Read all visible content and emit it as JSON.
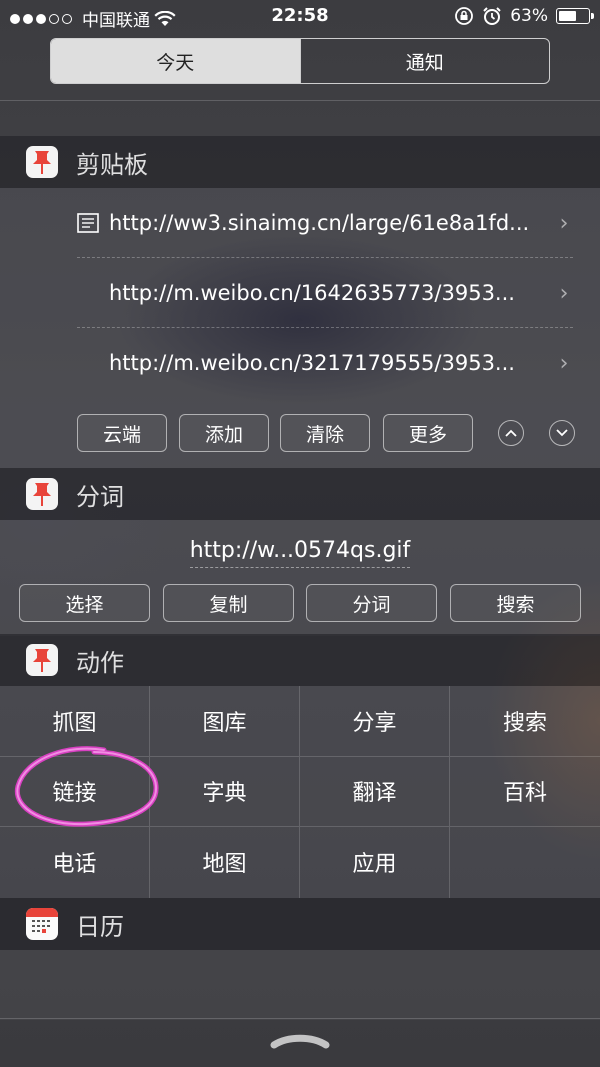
{
  "status_bar": {
    "carrier": "中国联通",
    "time": "22:58",
    "battery": "63%",
    "battery_level": 0.63
  },
  "tabs": [
    {
      "label": "今天",
      "selected": true
    },
    {
      "label": "通知",
      "selected": false
    }
  ],
  "clipboard_widget": {
    "title": "剪贴板",
    "items": [
      {
        "text": "http://ww3.sinaimg.cn/large/61e8a1fd...",
        "icon": "document-icon"
      },
      {
        "text": "http://m.weibo.cn/1642635773/3953..."
      },
      {
        "text": "http://m.weibo.cn/3217179555/3953..."
      }
    ],
    "buttons": [
      "云端",
      "添加",
      "清除",
      "更多"
    ]
  },
  "segment_widget": {
    "title": "分词",
    "text": "http://w...0574qs.gif",
    "buttons": [
      "选择",
      "复制",
      "分词",
      "搜索"
    ]
  },
  "action_widget": {
    "title": "动作",
    "actions": [
      "抓图",
      "图库",
      "分享",
      "搜索",
      "链接",
      "字典",
      "翻译",
      "百科",
      "电话",
      "地图",
      "应用",
      ""
    ]
  },
  "calendar_widget": {
    "title": "日历"
  },
  "colors": {
    "pin_red": "#e8443a",
    "highlight_circle": "#e040c8"
  }
}
